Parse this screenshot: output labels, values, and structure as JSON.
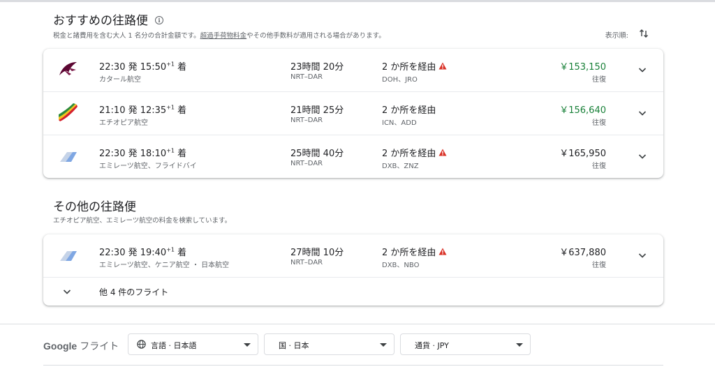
{
  "best": {
    "title": "おすすめの往路便",
    "subtitle_pre": "税金と諸費用を含む大人 1 名分の合計金額です。",
    "subtitle_link": "超過手荷物料金",
    "subtitle_post": "やその他手数料が適用される場合があります。",
    "sort_label": "表示順:"
  },
  "flights": [
    {
      "logo": "qatar-airways-logo",
      "depart": "22:30 発 15:50",
      "plus": "+1",
      "arr_suffix": " 着",
      "airline": "カタール航空",
      "duration": "23時間 20分",
      "route": "NRT–DAR",
      "stops": "2 か所を経由",
      "warning": true,
      "via": "DOH、JRO",
      "price": "￥153,150",
      "price_color": "#188038",
      "trip": "往復"
    },
    {
      "logo": "ethiopian-airlines-logo",
      "depart": "21:10 発 12:35",
      "plus": "+1",
      "arr_suffix": " 着",
      "airline": "エチオピア航空",
      "duration": "21時間 25分",
      "route": "NRT–DAR",
      "stops": "2 か所を経由",
      "warning": false,
      "via": "ICN、ADD",
      "price": "￥156,640",
      "price_color": "#188038",
      "trip": "往復"
    },
    {
      "logo": "multi-airline-logo",
      "depart": "22:30 発 18:10",
      "plus": "+1",
      "arr_suffix": " 着",
      "airline": "エミレーツ航空、フライドバイ",
      "duration": "25時間 40分",
      "route": "NRT–DAR",
      "stops": "2 か所を経由",
      "warning": true,
      "via": "DXB、ZNZ",
      "price": "￥165,950",
      "price_color": "#202124",
      "trip": "往復"
    }
  ],
  "other": {
    "title": "その他の往路便",
    "subtitle": "エチオピア航空、エミレーツ航空の料金を検索しています。",
    "flight": {
      "depart": "22:30 発 19:40",
      "plus": "+1",
      "arr_suffix": " 着",
      "airline": "エミレーツ航空、ケニア航空 ・ 日本航空",
      "duration": "27時間 10分",
      "route": "NRT–DAR",
      "stops": "2 か所を経由",
      "via": "DXB、NBO",
      "price": "￥637,880",
      "trip": "往復"
    },
    "more_label": "他 4 件のフライト"
  },
  "footer": {
    "brand_google": "Google",
    "brand_product": "フライト",
    "language": "言語 · 日本語",
    "country": "国 · 日本",
    "currency": "通貨 · JPY"
  },
  "colors": {
    "accent_green": "#188038",
    "warning_red": "#d93025"
  }
}
